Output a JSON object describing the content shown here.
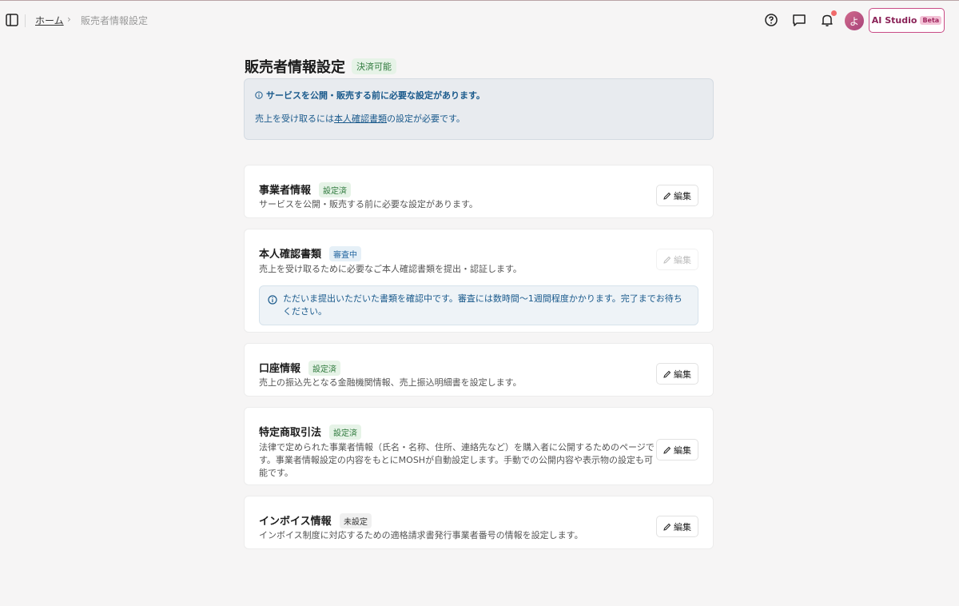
{
  "breadcrumb": {
    "home": "ホーム",
    "separator": "›",
    "current": "販売者情報設定"
  },
  "header": {
    "avatar_initial": "よ",
    "ai_studio_label": "AI Studio",
    "beta_label": "Beta"
  },
  "page": {
    "title": "販売者情報設定",
    "title_badge": "決済可能"
  },
  "alert": {
    "title": "サービスを公開・販売する前に必要な設定があります。",
    "body_prefix": "売上を受け取るには",
    "body_link": "本人確認書類",
    "body_suffix": "の設定が必要です。"
  },
  "cards": [
    {
      "title": "事業者情報",
      "badge": "設定済",
      "description": "サービスを公開・販売する前に必要な設定があります。",
      "edit_label": "編集"
    },
    {
      "title": "本人確認書類",
      "badge": "審査中",
      "description": "売上を受け取るために必要なご本人確認書類を提出・認証します。",
      "edit_label": "編集",
      "info": "ただいま提出いただいた書類を確認中です。審査には数時間〜1週間程度かかります。完了までお待ちください。"
    },
    {
      "title": "口座情報",
      "badge": "設定済",
      "description": "売上の振込先となる金融機関情報、売上振込明細書を設定します。",
      "edit_label": "編集"
    },
    {
      "title": "特定商取引法",
      "badge": "設定済",
      "description": "法律で定められた事業者情報（氏名・名称、住所、連絡先など）を購入者に公開するためのページです。事業者情報設定の内容をもとにMOSHが自動設定します。手動での公開内容や表示物の設定も可能です。",
      "edit_label": "編集"
    },
    {
      "title": "インボイス情報",
      "badge": "未設定",
      "description": "インボイス制度に対応するための適格請求書発行事業者番号の情報を設定します。",
      "edit_label": "編集"
    }
  ],
  "colors": {
    "accent": "#c94b86",
    "done": "#2f7a3d",
    "review": "#2567a1",
    "info": "#1a5a8c"
  }
}
